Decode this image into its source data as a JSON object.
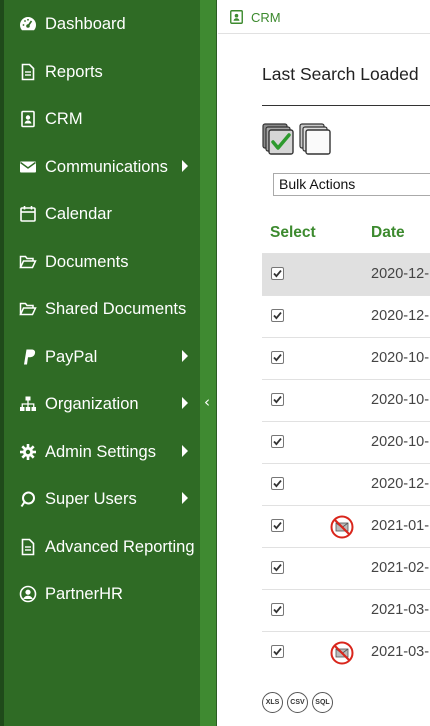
{
  "sidebar": {
    "items": [
      {
        "label": "Dashboard",
        "icon": "dashboard-icon",
        "has_submenu": false
      },
      {
        "label": "Reports",
        "icon": "document-icon",
        "has_submenu": false
      },
      {
        "label": "CRM",
        "icon": "contact-card-icon",
        "has_submenu": false
      },
      {
        "label": "Communications",
        "icon": "envelope-icon",
        "has_submenu": true
      },
      {
        "label": "Calendar",
        "icon": "calendar-icon",
        "has_submenu": false
      },
      {
        "label": "Documents",
        "icon": "folder-open-icon",
        "has_submenu": false
      },
      {
        "label": "Shared Documents",
        "icon": "folder-open-icon",
        "has_submenu": false
      },
      {
        "label": "PayPal",
        "icon": "paypal-icon",
        "has_submenu": true
      },
      {
        "label": "Organization",
        "icon": "sitemap-icon",
        "has_submenu": true
      },
      {
        "label": "Admin Settings",
        "icon": "gear-icon",
        "has_submenu": true
      },
      {
        "label": "Super Users",
        "icon": "super-user-icon",
        "has_submenu": true
      },
      {
        "label": "Advanced Reporting",
        "icon": "document-icon",
        "has_submenu": false
      },
      {
        "label": "PartnerHR",
        "icon": "user-circle-icon",
        "has_submenu": false
      }
    ],
    "collapse_glyph": "‹"
  },
  "breadcrumb": {
    "label": "CRM"
  },
  "main": {
    "title": "Last Search Loaded",
    "bulk_actions": "Bulk Actions",
    "columns": {
      "select": "Select",
      "date": "Date"
    },
    "rows": [
      {
        "checked": true,
        "no_email": false,
        "date": "2020-12-",
        "highlight": true
      },
      {
        "checked": true,
        "no_email": false,
        "date": "2020-12-",
        "highlight": false
      },
      {
        "checked": true,
        "no_email": false,
        "date": "2020-10-",
        "highlight": false
      },
      {
        "checked": true,
        "no_email": false,
        "date": "2020-10-",
        "highlight": false
      },
      {
        "checked": true,
        "no_email": false,
        "date": "2020-10-",
        "highlight": false
      },
      {
        "checked": true,
        "no_email": false,
        "date": "2020-12-",
        "highlight": false
      },
      {
        "checked": true,
        "no_email": true,
        "date": "2021-01-",
        "highlight": false
      },
      {
        "checked": true,
        "no_email": false,
        "date": "2021-02-",
        "highlight": false
      },
      {
        "checked": true,
        "no_email": false,
        "date": "2021-03-",
        "highlight": false
      },
      {
        "checked": true,
        "no_email": true,
        "date": "2021-03-",
        "highlight": false
      }
    ],
    "exports": [
      "XLS",
      "CSV",
      "SQL"
    ]
  },
  "colors": {
    "sidebar": "#2f6b25",
    "accent": "#3c8a2e",
    "no_email": "#d9261c"
  }
}
